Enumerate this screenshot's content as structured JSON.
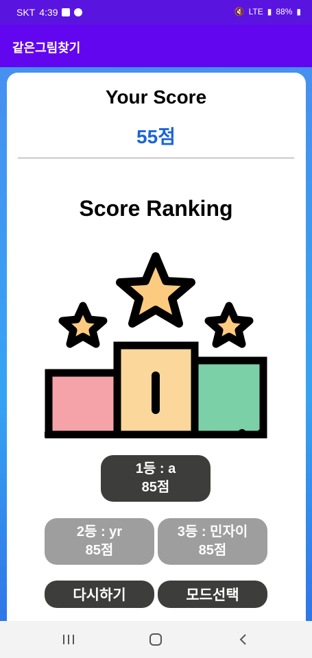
{
  "status_bar": {
    "carrier": "SKT",
    "time": "4:39",
    "battery": "88%",
    "network": "LTE"
  },
  "app_bar": {
    "title": "같은그림찾기"
  },
  "score": {
    "label": "Your Score",
    "value": "55점"
  },
  "ranking": {
    "title": "Score Ranking",
    "first": {
      "name": "1등 : a",
      "score": "85점"
    },
    "second": {
      "name": "2등 : yr",
      "score": "85점"
    },
    "third": {
      "name": "3등 : 민자이",
      "score": "85점"
    }
  },
  "buttons": {
    "retry": "다시하기",
    "mode_select": "모드선택"
  },
  "colors": {
    "app_bar": "#6306f0",
    "score_value": "#1a64d8",
    "podium_pink": "#f5a3a9",
    "podium_peach": "#fcd79c",
    "podium_green": "#7cd0a8",
    "star": "#fdcb80"
  },
  "icons": {
    "podium": "podium-with-stars-icon"
  }
}
